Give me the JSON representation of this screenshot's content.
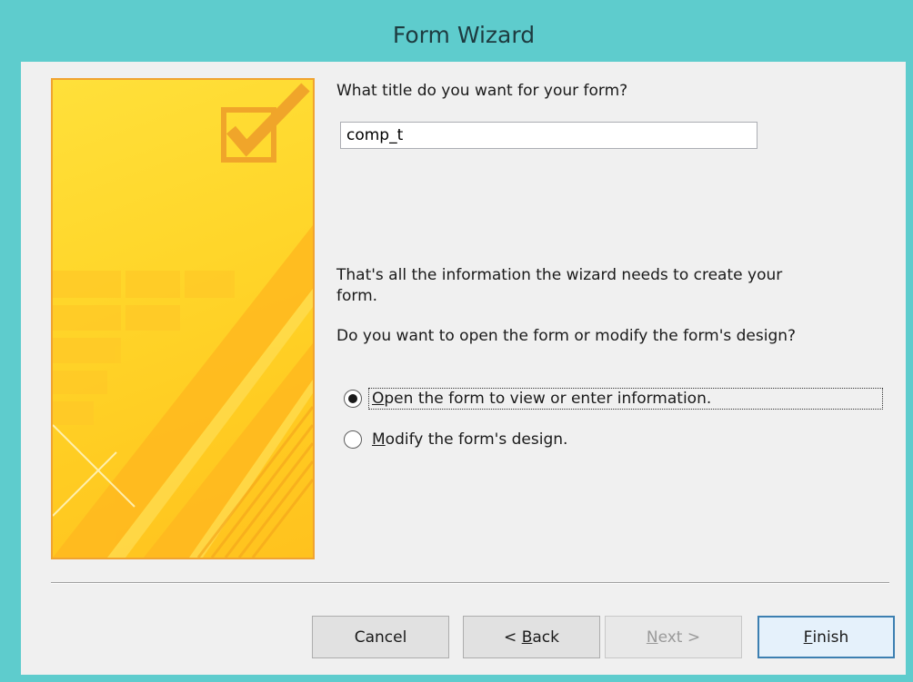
{
  "window": {
    "title": "Form Wizard"
  },
  "prompt": {
    "question": "What title do you want for your form?"
  },
  "title_field": {
    "value": "comp_t"
  },
  "info": {
    "line1": "That's all the information the wizard needs to create your",
    "line2": "form.",
    "question": "Do you want to open the form or modify the form's design?"
  },
  "options": [
    {
      "accesskey": "O",
      "rest": "pen the form to view or enter information.",
      "selected": true
    },
    {
      "accesskey": "M",
      "rest": "odify the form's design.",
      "selected": false
    }
  ],
  "buttons": {
    "cancel": "Cancel",
    "back_prefix": "< ",
    "back_key": "B",
    "back_rest": "ack",
    "next_key": "N",
    "next_rest": "ext >",
    "finish_key": "F",
    "finish_rest": "inish"
  },
  "colors": {
    "titlebar": "#5ecccd",
    "art": "#ffd62a",
    "default_button_border": "#3c7fb1"
  }
}
